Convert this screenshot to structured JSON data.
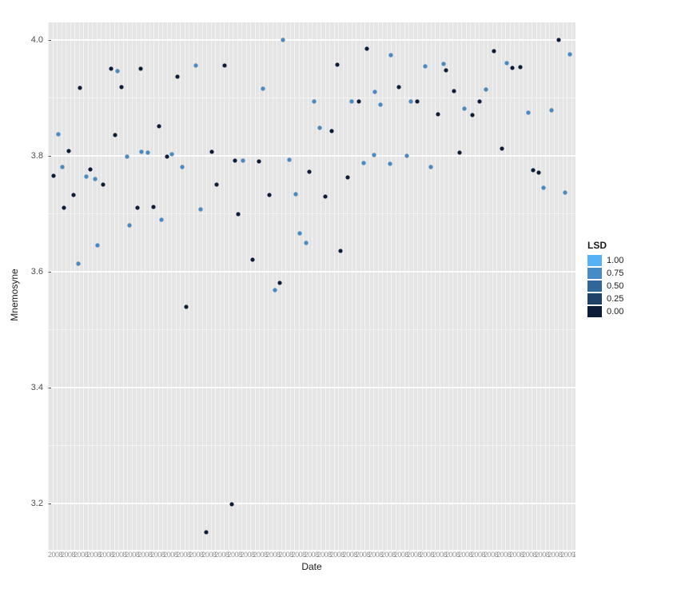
{
  "chart_data": {
    "type": "scatter",
    "xlabel": "Date",
    "ylabel": "Mnemosyne",
    "ylim": [
      3.12,
      4.03
    ],
    "y_breaks": [
      3.2,
      3.4,
      3.6,
      3.8,
      4.0
    ],
    "x_is_categorical_dates": true,
    "x_tick_sample": [
      "2008",
      "2009"
    ],
    "color_var": "LSD",
    "color_scale": {
      "low": "#0b1d39",
      "high": "#56b1f7",
      "breaks": [
        0.0,
        0.25,
        0.5,
        0.75,
        1.0
      ]
    },
    "legend_title": "LSD",
    "points": [
      {
        "xi": 0.01,
        "y": 3.765,
        "lsd": 0.0
      },
      {
        "xi": 0.02,
        "y": 3.837,
        "lsd": 0.75
      },
      {
        "xi": 0.03,
        "y": 3.71,
        "lsd": 0.0
      },
      {
        "xi": 0.028,
        "y": 3.78,
        "lsd": 0.75
      },
      {
        "xi": 0.04,
        "y": 3.808,
        "lsd": 0.0
      },
      {
        "xi": 0.048,
        "y": 3.732,
        "lsd": 0.0
      },
      {
        "xi": 0.06,
        "y": 3.917,
        "lsd": 0.0
      },
      {
        "xi": 0.058,
        "y": 3.614,
        "lsd": 0.75
      },
      {
        "xi": 0.072,
        "y": 3.764,
        "lsd": 0.75
      },
      {
        "xi": 0.08,
        "y": 3.776,
        "lsd": 0.0
      },
      {
        "xi": 0.09,
        "y": 3.76,
        "lsd": 0.75
      },
      {
        "xi": 0.094,
        "y": 3.645,
        "lsd": 0.75
      },
      {
        "xi": 0.105,
        "y": 3.75,
        "lsd": 0.0
      },
      {
        "xi": 0.12,
        "y": 3.95,
        "lsd": 0.0
      },
      {
        "xi": 0.128,
        "y": 3.835,
        "lsd": 0.0
      },
      {
        "xi": 0.132,
        "y": 3.946,
        "lsd": 0.75
      },
      {
        "xi": 0.14,
        "y": 3.918,
        "lsd": 0.0
      },
      {
        "xi": 0.15,
        "y": 3.798,
        "lsd": 0.75
      },
      {
        "xi": 0.155,
        "y": 3.68,
        "lsd": 0.75
      },
      {
        "xi": 0.17,
        "y": 3.71,
        "lsd": 0.0
      },
      {
        "xi": 0.175,
        "y": 3.95,
        "lsd": 0.0
      },
      {
        "xi": 0.178,
        "y": 3.807,
        "lsd": 0.75
      },
      {
        "xi": 0.19,
        "y": 3.805,
        "lsd": 0.75
      },
      {
        "xi": 0.2,
        "y": 3.711,
        "lsd": 0.0
      },
      {
        "xi": 0.21,
        "y": 3.851,
        "lsd": 0.0
      },
      {
        "xi": 0.215,
        "y": 3.689,
        "lsd": 0.75
      },
      {
        "xi": 0.225,
        "y": 3.798,
        "lsd": 0.0
      },
      {
        "xi": 0.235,
        "y": 3.803,
        "lsd": 0.75
      },
      {
        "xi": 0.245,
        "y": 3.936,
        "lsd": 0.0
      },
      {
        "xi": 0.255,
        "y": 3.78,
        "lsd": 0.75
      },
      {
        "xi": 0.262,
        "y": 3.539,
        "lsd": 0.0
      },
      {
        "xi": 0.28,
        "y": 3.955,
        "lsd": 0.75
      },
      {
        "xi": 0.29,
        "y": 3.707,
        "lsd": 0.75
      },
      {
        "xi": 0.3,
        "y": 3.15,
        "lsd": 0.0
      },
      {
        "xi": 0.31,
        "y": 3.806,
        "lsd": 0.0
      },
      {
        "xi": 0.32,
        "y": 3.75,
        "lsd": 0.0
      },
      {
        "xi": 0.335,
        "y": 3.956,
        "lsd": 0.0
      },
      {
        "xi": 0.348,
        "y": 3.198,
        "lsd": 0.0
      },
      {
        "xi": 0.355,
        "y": 3.792,
        "lsd": 0.0
      },
      {
        "xi": 0.36,
        "y": 3.699,
        "lsd": 0.0
      },
      {
        "xi": 0.37,
        "y": 3.792,
        "lsd": 0.75
      },
      {
        "xi": 0.388,
        "y": 3.62,
        "lsd": 0.0
      },
      {
        "xi": 0.4,
        "y": 3.79,
        "lsd": 0.0
      },
      {
        "xi": 0.408,
        "y": 3.915,
        "lsd": 0.75
      },
      {
        "xi": 0.42,
        "y": 3.732,
        "lsd": 0.0
      },
      {
        "xi": 0.43,
        "y": 3.568,
        "lsd": 0.75
      },
      {
        "xi": 0.44,
        "y": 3.58,
        "lsd": 0.0
      },
      {
        "xi": 0.445,
        "y": 3.999,
        "lsd": 0.75
      },
      {
        "xi": 0.458,
        "y": 3.793,
        "lsd": 0.75
      },
      {
        "xi": 0.47,
        "y": 3.734,
        "lsd": 0.75
      },
      {
        "xi": 0.478,
        "y": 3.666,
        "lsd": 0.75
      },
      {
        "xi": 0.49,
        "y": 3.65,
        "lsd": 0.75
      },
      {
        "xi": 0.495,
        "y": 3.772,
        "lsd": 0.0
      },
      {
        "xi": 0.505,
        "y": 3.893,
        "lsd": 0.75
      },
      {
        "xi": 0.515,
        "y": 3.848,
        "lsd": 0.75
      },
      {
        "xi": 0.525,
        "y": 3.729,
        "lsd": 0.0
      },
      {
        "xi": 0.538,
        "y": 3.843,
        "lsd": 0.0
      },
      {
        "xi": 0.548,
        "y": 3.957,
        "lsd": 0.0
      },
      {
        "xi": 0.555,
        "y": 3.636,
        "lsd": 0.0
      },
      {
        "xi": 0.568,
        "y": 3.762,
        "lsd": 0.0
      },
      {
        "xi": 0.575,
        "y": 3.894,
        "lsd": 0.75
      },
      {
        "xi": 0.59,
        "y": 3.893,
        "lsd": 0.0
      },
      {
        "xi": 0.598,
        "y": 3.787,
        "lsd": 0.75
      },
      {
        "xi": 0.605,
        "y": 3.984,
        "lsd": 0.0
      },
      {
        "xi": 0.618,
        "y": 3.801,
        "lsd": 0.75
      },
      {
        "xi": 0.62,
        "y": 3.91,
        "lsd": 0.75
      },
      {
        "xi": 0.63,
        "y": 3.888,
        "lsd": 0.75
      },
      {
        "xi": 0.648,
        "y": 3.786,
        "lsd": 0.75
      },
      {
        "xi": 0.65,
        "y": 3.973,
        "lsd": 0.75
      },
      {
        "xi": 0.665,
        "y": 3.918,
        "lsd": 0.0
      },
      {
        "xi": 0.68,
        "y": 3.8,
        "lsd": 0.75
      },
      {
        "xi": 0.688,
        "y": 3.893,
        "lsd": 0.75
      },
      {
        "xi": 0.7,
        "y": 3.894,
        "lsd": 0.0
      },
      {
        "xi": 0.715,
        "y": 3.954,
        "lsd": 0.75
      },
      {
        "xi": 0.725,
        "y": 3.781,
        "lsd": 0.75
      },
      {
        "xi": 0.74,
        "y": 3.872,
        "lsd": 0.0
      },
      {
        "xi": 0.75,
        "y": 3.958,
        "lsd": 0.75
      },
      {
        "xi": 0.755,
        "y": 3.947,
        "lsd": 0.0
      },
      {
        "xi": 0.77,
        "y": 3.912,
        "lsd": 0.0
      },
      {
        "xi": 0.78,
        "y": 3.805,
        "lsd": 0.0
      },
      {
        "xi": 0.79,
        "y": 3.881,
        "lsd": 0.75
      },
      {
        "xi": 0.805,
        "y": 3.87,
        "lsd": 0.0
      },
      {
        "xi": 0.818,
        "y": 3.893,
        "lsd": 0.0
      },
      {
        "xi": 0.83,
        "y": 3.914,
        "lsd": 0.75
      },
      {
        "xi": 0.845,
        "y": 3.98,
        "lsd": 0.0
      },
      {
        "xi": 0.86,
        "y": 3.812,
        "lsd": 0.0
      },
      {
        "xi": 0.87,
        "y": 3.96,
        "lsd": 0.75
      },
      {
        "xi": 0.88,
        "y": 3.951,
        "lsd": 0.0
      },
      {
        "xi": 0.895,
        "y": 3.953,
        "lsd": 0.0
      },
      {
        "xi": 0.91,
        "y": 3.874,
        "lsd": 0.75
      },
      {
        "xi": 0.92,
        "y": 3.775,
        "lsd": 0.0
      },
      {
        "xi": 0.93,
        "y": 3.771,
        "lsd": 0.0
      },
      {
        "xi": 0.94,
        "y": 3.744,
        "lsd": 0.75
      },
      {
        "xi": 0.955,
        "y": 3.878,
        "lsd": 0.75
      },
      {
        "xi": 0.968,
        "y": 4.0,
        "lsd": 0.0
      },
      {
        "xi": 0.98,
        "y": 3.737,
        "lsd": 0.75
      },
      {
        "xi": 0.99,
        "y": 3.975,
        "lsd": 0.75
      }
    ]
  }
}
